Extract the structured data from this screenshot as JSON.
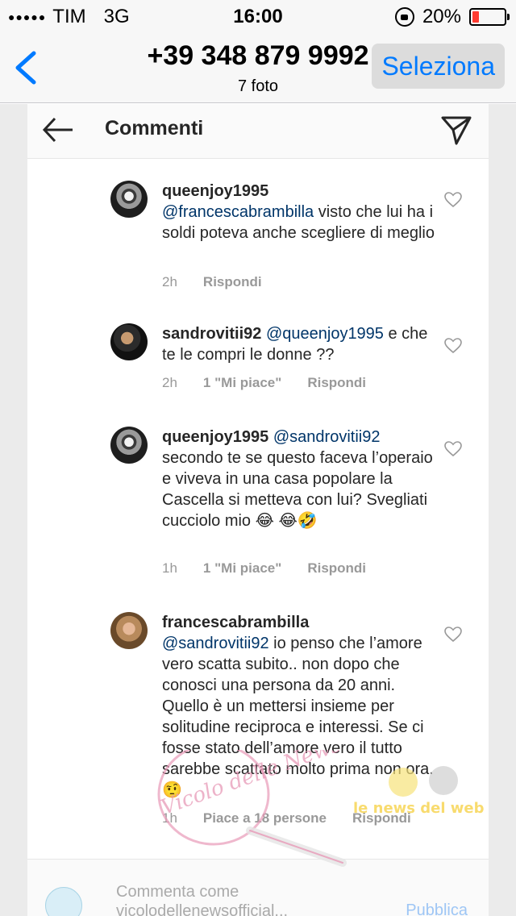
{
  "status_bar": {
    "signal_dots": "●●●●●",
    "carrier": "TIM",
    "network": "3G",
    "time": "16:00",
    "battery_percent": "20%",
    "battery_level": 0.2,
    "battery_color": "#ff3b30"
  },
  "photos_nav": {
    "title": "+39 348 879 9992",
    "subtitle": "7 foto",
    "select_label": "Seleziona",
    "accent_color": "#007aff"
  },
  "instagram": {
    "header": {
      "title": "Commenti"
    },
    "comments": [
      {
        "avatar": "marilyn-avatar",
        "username": "queenjoy1995",
        "mention": "@francescabrambilla",
        "text": "visto che lui ha i soldi poteva anche scegliere di meglio",
        "time": "2h",
        "likes": "",
        "reply": "Rispondi"
      },
      {
        "avatar": "sandro-avatar",
        "username": "sandrovitii92",
        "mention": "@queenjoy1995",
        "text": "e che te le compri le donne ??",
        "time": "2h",
        "likes": "1 \"Mi piace\"",
        "reply": "Rispondi"
      },
      {
        "avatar": "marilyn-avatar",
        "username": "queenjoy1995",
        "mention": "@sandrovitii92",
        "text": "secondo te se questo faceva l’operaio e viveva in una casa popolare la Cascella si metteva con lui? Svegliati cucciolo mio 😂 😂🤣",
        "time": "1h",
        "likes": "1 \"Mi piace\"",
        "reply": "Rispondi"
      },
      {
        "avatar": "francesca-avatar",
        "username": "francescabrambilla",
        "mention": "@sandrovitii92",
        "text": "io penso che l’amore vero scatta subito.. non dopo che conosci una persona da 20 anni. Quello è un mettersi insieme per solitudine reciproca e interessi. Se ci fosse stato dell’amore vero il tutto sarebbe scattato molto prima non ora. 🤨",
        "time": "1h",
        "likes": "Piace a 18 persone",
        "reply": "Rispondi"
      }
    ],
    "composer": {
      "placeholder": "Commenta come vicolodellenewsofficial...",
      "publish_label": "Pubblica"
    }
  },
  "watermark": {
    "left_text": "Vicolo delle News",
    "right_text": "le news del web"
  }
}
